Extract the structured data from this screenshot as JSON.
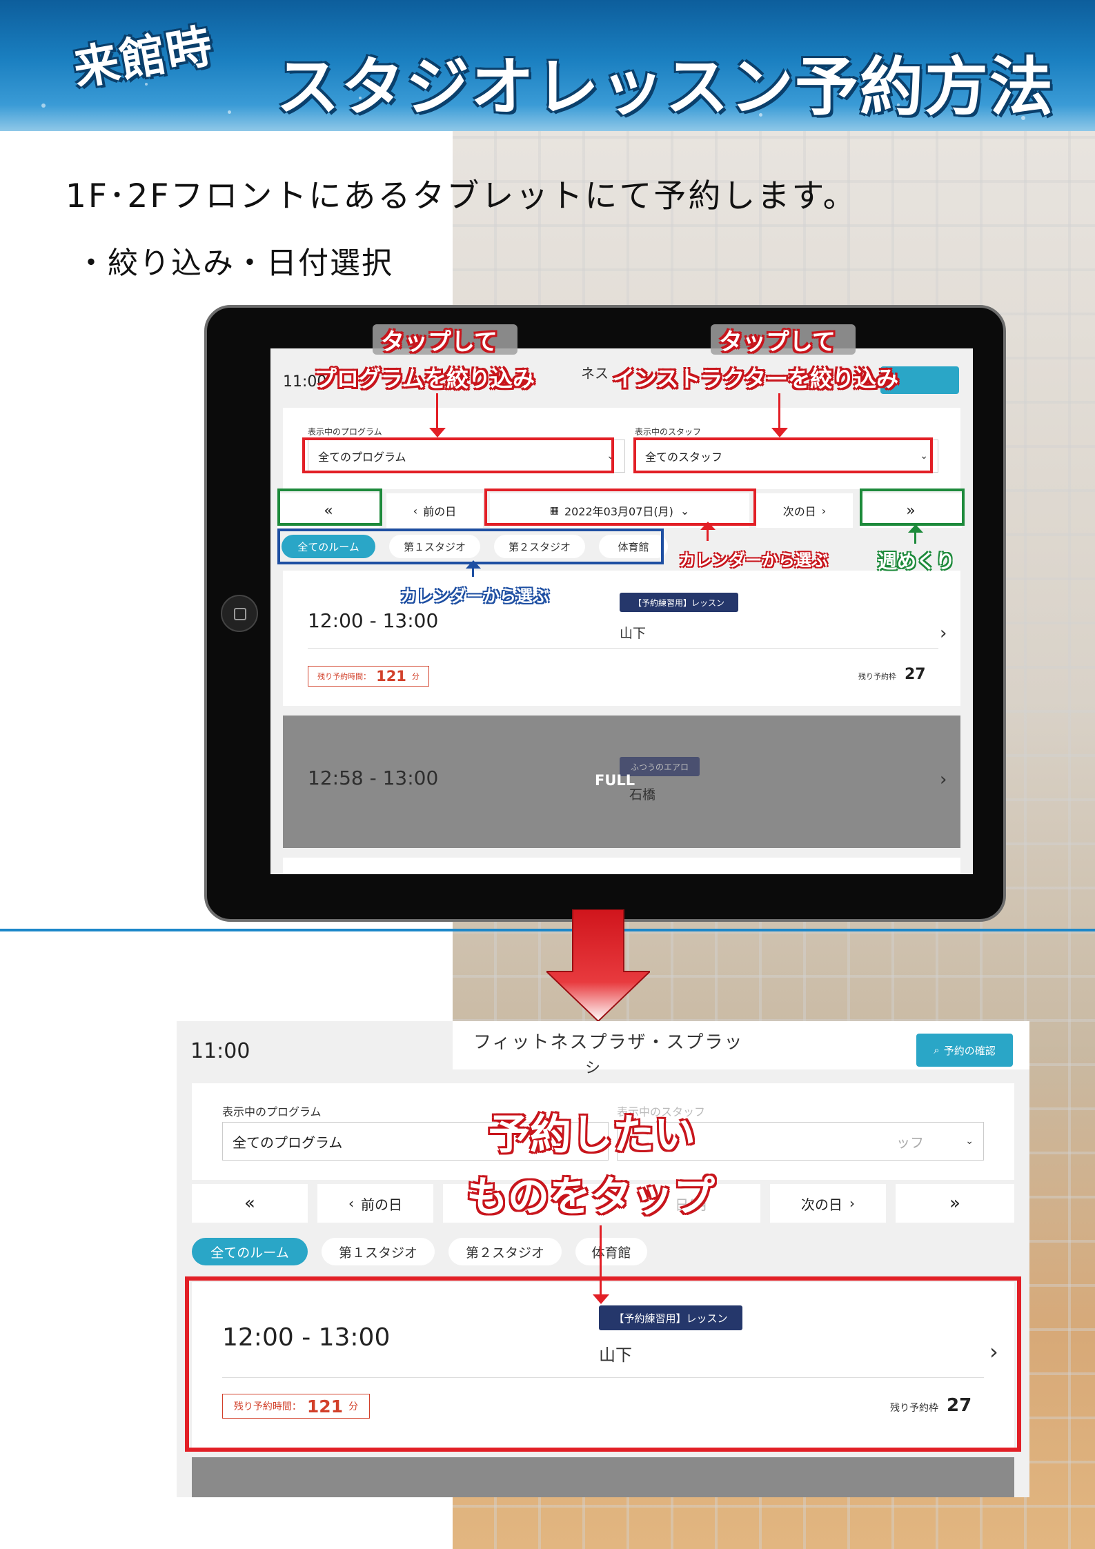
{
  "banner": {
    "tag": "来館時",
    "title": "スタジオレッスン予約方法"
  },
  "intro": "1F･2Fフロントにあるタブレットにて予約します。",
  "sub": "・絞り込み・日付選択",
  "tablet": {
    "clock": "11:00",
    "facility_partial": "ネス",
    "program_label": "表示中のプログラム",
    "program_value": "全てのプログラム",
    "staff_label": "表示中のスタッフ",
    "staff_value": "全てのスタッフ",
    "nav_week_back": "«",
    "nav_prev_day": "前の日",
    "nav_date": "2022年03月07日(月)",
    "nav_next_day": "次の日",
    "nav_week_fwd": "»",
    "rooms": [
      "全てのルーム",
      "第１スタジオ",
      "第２スタジオ",
      "体育館"
    ],
    "lesson1": {
      "time": "12:00 - 13:00",
      "tag": "【予約練習用】レッスン",
      "instructor": "山下",
      "remain_label": "残り予約時間：",
      "remain_value": "121",
      "remain_unit": "分",
      "seats_label": "残り予約枠",
      "seats_value": "27"
    },
    "lesson2": {
      "time": "12:58 - 13:00",
      "tag": "ふつうのエアロ",
      "instructor": "石橋",
      "status": "FULL"
    }
  },
  "callouts": {
    "tap1": "タップして",
    "tap1b": "プログラムを絞り込み",
    "tap2": "タップして",
    "tap2b": "インストラクターを絞り込み",
    "calendar_red": "カレンダーから選ぶ",
    "week_green": "週めくり",
    "calendar_blue": "カレンダーから選ぶ",
    "tap_big_1": "予約したい",
    "tap_big_2": "ものをタップ"
  },
  "zoom": {
    "clock": "11:00",
    "facility": "フィットネスプラザ・スプラッ",
    "facility_wrap": "シ",
    "confirm_button": "予約の確認",
    "program_label": "表示中のプログラム",
    "program_value": "全てのプログラム",
    "staff_label_partial": "表示中のスタッフ",
    "staff_value_partial": "ッフ",
    "nav_week_back": "«",
    "nav_prev_day": "前の日",
    "nav_date_partial": "日(月",
    "nav_next_day": "次の日",
    "nav_week_fwd": "»",
    "rooms": [
      "全てのルーム",
      "第１スタジオ",
      "第２スタジオ",
      "体育館"
    ],
    "lesson1": {
      "time": "12:00 - 13:00",
      "tag": "【予約練習用】レッスン",
      "instructor": "山下",
      "remain_label": "残り予約時間：",
      "remain_value": "121",
      "remain_unit": "分",
      "seats_label": "残り予約枠",
      "seats_value": "27"
    }
  },
  "colors": {
    "accent": "#2aa6c7",
    "tag": "#25376b",
    "remain": "#d2402a",
    "red_frame": "#e21f26",
    "green_frame": "#1d8a3b",
    "blue_frame": "#1e4fa2"
  }
}
